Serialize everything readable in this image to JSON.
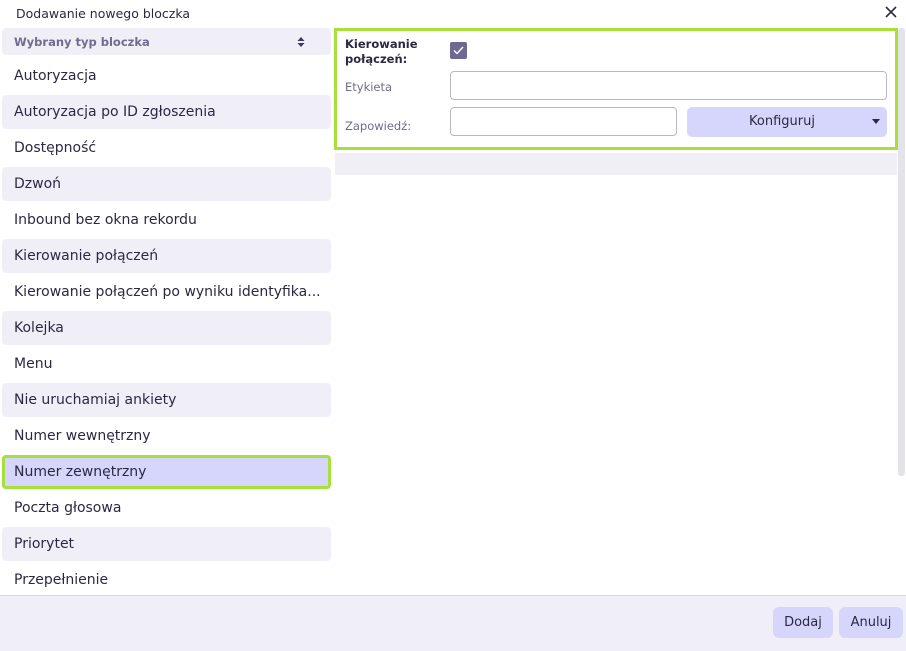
{
  "dialog": {
    "title": "Dodawanie nowego bloczka"
  },
  "sidebar": {
    "header_label": "Wybrany typ bloczka",
    "items": [
      {
        "label": "Autoryzacja"
      },
      {
        "label": "Autoryzacja po ID zgłoszenia"
      },
      {
        "label": "Dostępność"
      },
      {
        "label": "Dzwoń"
      },
      {
        "label": "Inbound bez okna rekordu"
      },
      {
        "label": "Kierowanie połączeń"
      },
      {
        "label": "Kierowanie połączeń po wyniku identyfika..."
      },
      {
        "label": "Kolejka"
      },
      {
        "label": "Menu"
      },
      {
        "label": "Nie uruchamiaj ankiety"
      },
      {
        "label": "Numer wewnętrzny"
      },
      {
        "label": "Numer zewnętrzny",
        "selected": true
      },
      {
        "label": "Poczta głosowa"
      },
      {
        "label": "Priorytet"
      },
      {
        "label": "Przepełnienie"
      }
    ]
  },
  "form": {
    "routing_label_line1": "Kierowanie",
    "routing_label_line2": "połączeń:",
    "routing_checked": true,
    "label_field_label": "Etykieta",
    "label_field_value": "",
    "announcement_label": "Zapowiedź:",
    "announcement_value": "",
    "configure_button": "Konfiguruj"
  },
  "footer": {
    "add_button": "Dodaj",
    "cancel_button": "Anuluj"
  },
  "colors": {
    "accent_button": "#d6d5fb",
    "highlight_outline": "#a7e03b",
    "checkbox": "#6f6891",
    "row_alt": "#f0eff7"
  }
}
